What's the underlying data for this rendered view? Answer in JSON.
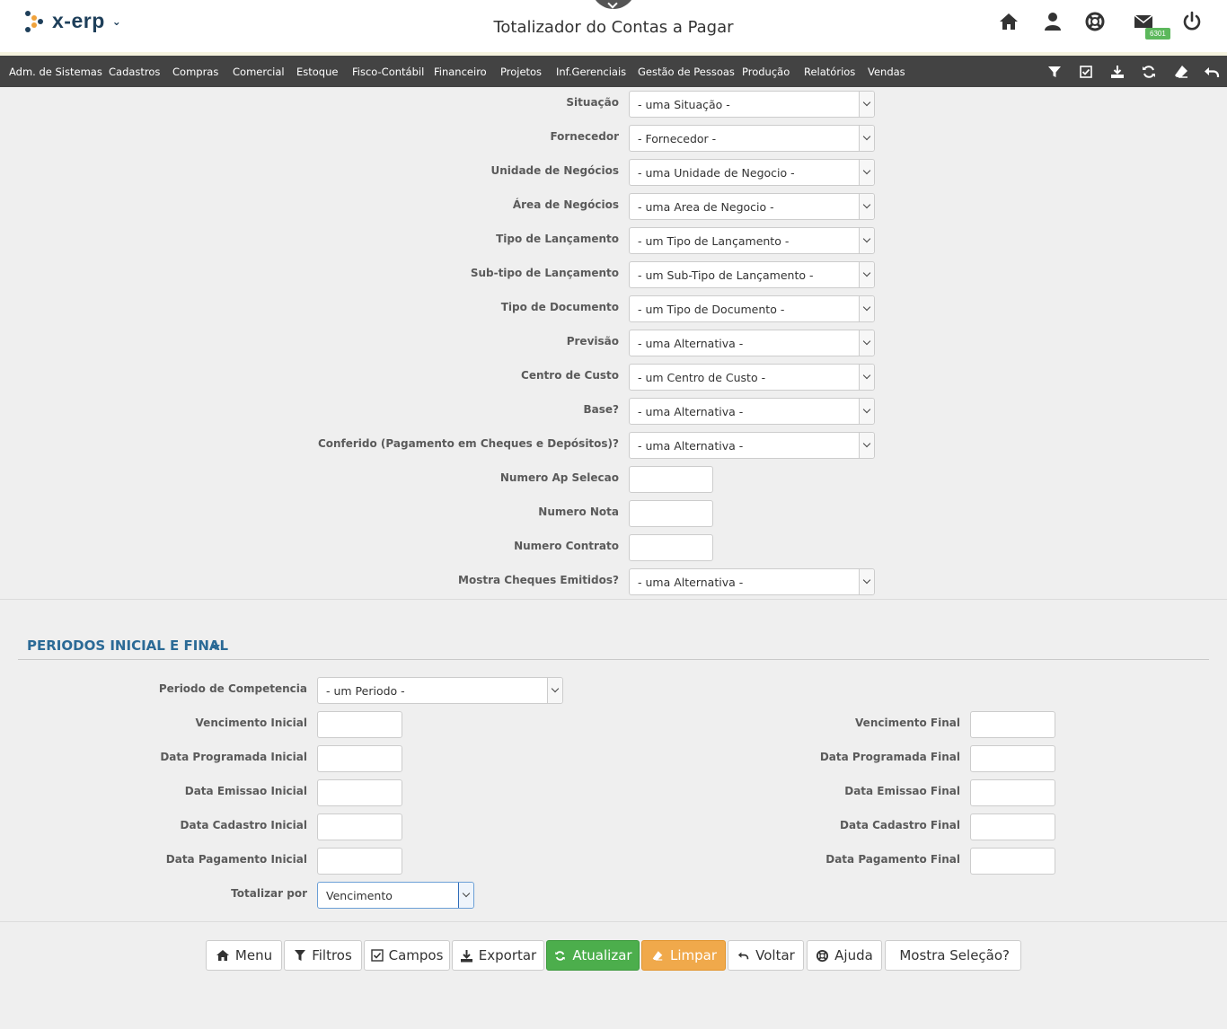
{
  "header": {
    "logo_text": "x-erp",
    "page_title": "Totalizador do Contas a Pagar",
    "mail_badge": "6301"
  },
  "nav": {
    "items": [
      "Adm. de Sistemas",
      "Cadastros",
      "Compras",
      "Comercial",
      "Estoque",
      "Fisco-Contábil",
      "Financeiro",
      "Projetos",
      "Inf.Gerenciais",
      "Gestão de Pessoas",
      "Produção",
      "Relatórios",
      "Vendas"
    ]
  },
  "filters": [
    {
      "label": "Situação",
      "type": "select",
      "value": "- uma Situação -"
    },
    {
      "label": "Fornecedor",
      "type": "select",
      "value": "- Fornecedor -"
    },
    {
      "label": "Unidade de Negócios",
      "type": "select",
      "value": "- uma Unidade de Negocio -"
    },
    {
      "label": "Área de Negócios",
      "type": "select",
      "value": "- uma Area de Negocio -"
    },
    {
      "label": "Tipo de Lançamento",
      "type": "select",
      "value": "- um Tipo de Lançamento -"
    },
    {
      "label": "Sub-tipo de Lançamento",
      "type": "select",
      "value": "- um Sub-Tipo de Lançamento -"
    },
    {
      "label": "Tipo de Documento",
      "type": "select",
      "value": "- um Tipo de Documento -"
    },
    {
      "label": "Previsão",
      "type": "select",
      "value": "- uma Alternativa -"
    },
    {
      "label": "Centro de Custo",
      "type": "select",
      "value": "- um Centro de Custo -"
    },
    {
      "label": "Base?",
      "type": "select",
      "value": "- uma Alternativa -"
    },
    {
      "label": "Conferido (Pagamento em Cheques e Depósitos)?",
      "type": "select",
      "value": "- uma Alternativa -"
    },
    {
      "label": "Numero Ap Selecao",
      "type": "input",
      "value": ""
    },
    {
      "label": "Numero Nota",
      "type": "input",
      "value": ""
    },
    {
      "label": "Numero Contrato",
      "type": "input",
      "value": ""
    },
    {
      "label": "Mostra Cheques Emitidos?",
      "type": "select",
      "value": "- uma Alternativa -"
    }
  ],
  "periods": {
    "section_title": "PERIODOS INICIAL E FINAL",
    "competencia_label": "Periodo de Competencia",
    "competencia_value": "- um Periodo -",
    "left": [
      "Vencimento Inicial",
      "Data Programada Inicial",
      "Data Emissao Inicial",
      "Data Cadastro Inicial",
      "Data Pagamento Inicial"
    ],
    "right": [
      "Vencimento Final",
      "Data Programada Final",
      "Data Emissao Final",
      "Data Cadastro Final",
      "Data Pagamento Final"
    ],
    "totalizar_label": "Totalizar por",
    "totalizar_value": "Vencimento"
  },
  "buttons": {
    "menu": "Menu",
    "filtros": "Filtros",
    "campos": "Campos",
    "exportar": "Exportar",
    "atualizar": "Atualizar",
    "limpar": "Limpar",
    "voltar": "Voltar",
    "ajuda": "Ajuda",
    "mostra": "Mostra Seleção?"
  },
  "colors": {
    "nav_bg": "#434343",
    "accent_blue": "#2b6a96",
    "green": "#4cae4c",
    "orange": "#f0a94b"
  }
}
